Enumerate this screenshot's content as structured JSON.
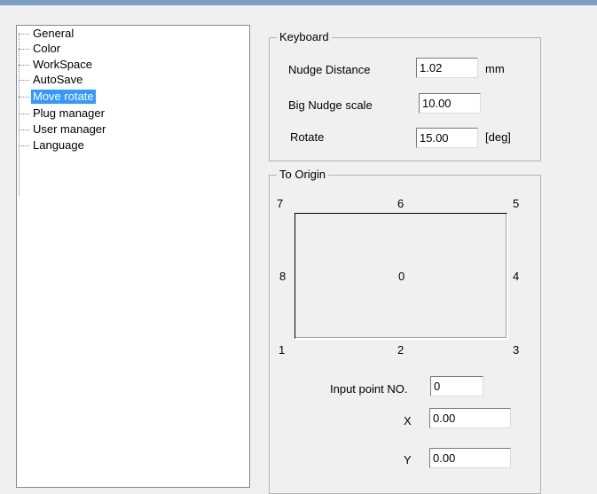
{
  "tree": {
    "items": [
      {
        "label": "General",
        "selected": false
      },
      {
        "label": "Color",
        "selected": false
      },
      {
        "label": "WorkSpace",
        "selected": false
      },
      {
        "label": "AutoSave",
        "selected": false
      },
      {
        "label": "Move rotate",
        "selected": true
      },
      {
        "label": "Plug manager",
        "selected": false
      },
      {
        "label": "User manager",
        "selected": false
      },
      {
        "label": "Language",
        "selected": false
      }
    ]
  },
  "keyboard": {
    "title": "Keyboard",
    "nudge_distance_label": "Nudge Distance",
    "nudge_distance_value": "1.02",
    "nudge_distance_unit": "mm",
    "big_nudge_label": "Big Nudge scale",
    "big_nudge_value": "10.00",
    "rotate_label": "Rotate",
    "rotate_value": "15.00",
    "rotate_unit": "[deg]"
  },
  "origin": {
    "title": "To Origin",
    "points": {
      "p0": "0",
      "p1": "1",
      "p2": "2",
      "p3": "3",
      "p4": "4",
      "p5": "5",
      "p6": "6",
      "p7": "7",
      "p8": "8"
    },
    "input_point_label": "Input point NO.",
    "input_point_value": "0",
    "x_label": "X",
    "x_value": "0.00",
    "y_label": "Y",
    "y_value": "0.00"
  }
}
